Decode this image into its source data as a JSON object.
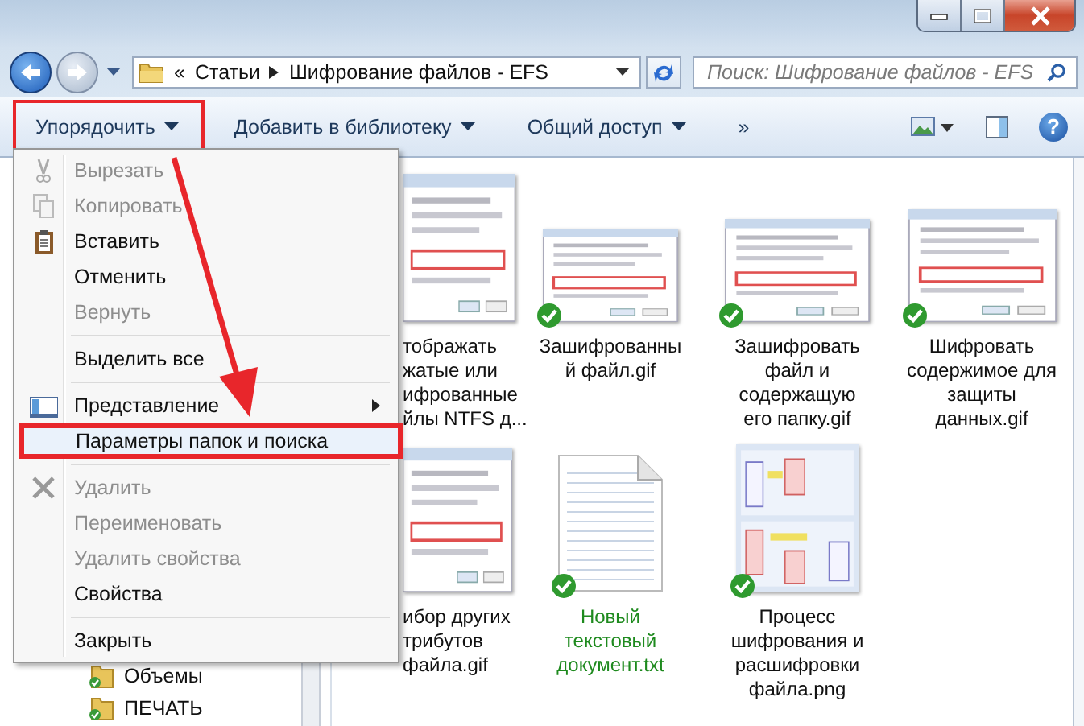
{
  "address": {
    "crumbs": [
      "«",
      "Статьи",
      "Шифрование файлов - EFS"
    ]
  },
  "search": {
    "placeholder": "Поиск: Шифрование файлов - EFS"
  },
  "toolbar": {
    "items": [
      {
        "label": "Упорядочить",
        "dropdown": true,
        "highlighted": true
      },
      {
        "label": "Добавить в библиотеку",
        "dropdown": true,
        "highlighted": false
      },
      {
        "label": "Общий доступ",
        "dropdown": true,
        "highlighted": false
      },
      {
        "label": "»",
        "dropdown": false,
        "highlighted": false
      }
    ],
    "help": "?"
  },
  "menu": {
    "items": [
      {
        "kind": "item",
        "label": "Вырезать",
        "disabled": true,
        "highlighted": false
      },
      {
        "kind": "item",
        "label": "Копировать",
        "disabled": true,
        "highlighted": false
      },
      {
        "kind": "item",
        "label": "Вставить",
        "disabled": false,
        "highlighted": false
      },
      {
        "kind": "item",
        "label": "Отменить",
        "disabled": false,
        "highlighted": false
      },
      {
        "kind": "item",
        "label": "Вернуть",
        "disabled": true,
        "highlighted": false
      },
      {
        "kind": "separator"
      },
      {
        "kind": "item",
        "label": "Выделить все",
        "disabled": false,
        "highlighted": false
      },
      {
        "kind": "separator"
      },
      {
        "kind": "item",
        "label": "Представление",
        "disabled": false,
        "highlighted": false,
        "submenu": true
      },
      {
        "kind": "item",
        "label": "Параметры папок и поиска",
        "disabled": false,
        "highlighted": true
      },
      {
        "kind": "separator"
      },
      {
        "kind": "item",
        "label": "Удалить",
        "disabled": true,
        "highlighted": false
      },
      {
        "kind": "item",
        "label": "Переименовать",
        "disabled": true,
        "highlighted": false
      },
      {
        "kind": "item",
        "label": "Удалить свойства",
        "disabled": true,
        "highlighted": false
      },
      {
        "kind": "item",
        "label": "Свойства",
        "disabled": false,
        "highlighted": false
      },
      {
        "kind": "separator"
      },
      {
        "kind": "item",
        "label": "Закрыть",
        "disabled": false,
        "highlighted": false
      }
    ]
  },
  "nav_pane": {
    "items": [
      {
        "label": "Объемы"
      },
      {
        "label": "ПЕЧАТЬ"
      }
    ]
  },
  "files": [
    {
      "kind": "picture",
      "lines": [
        "тображать",
        "жатые или",
        "ифрованные",
        "йлы NTFS д..."
      ],
      "encrypted": false
    },
    {
      "kind": "picture",
      "lines": [
        "Зашифрованны",
        "й файл.gif"
      ],
      "synced": true,
      "encrypted": false
    },
    {
      "kind": "picture",
      "lines": [
        "Зашифровать",
        "файл и",
        "содержащую",
        "его папку.gif"
      ],
      "synced": true,
      "encrypted": false
    },
    {
      "kind": "picture",
      "lines": [
        "Шифровать",
        "содержимое для",
        "защиты",
        "данных.gif"
      ],
      "synced": true,
      "encrypted": false
    },
    {
      "kind": "picture",
      "lines": [
        "ибор других",
        "трибутов",
        "файла.gif"
      ],
      "encrypted": false
    },
    {
      "kind": "document",
      "lines": [
        "Новый",
        "текстовый",
        "документ.txt"
      ],
      "synced": true,
      "encrypted": true
    },
    {
      "kind": "picture",
      "lines": [
        "Процесс",
        "шифрования и",
        "расшифровки",
        "файла.png"
      ],
      "synced": true,
      "encrypted": false
    }
  ]
}
